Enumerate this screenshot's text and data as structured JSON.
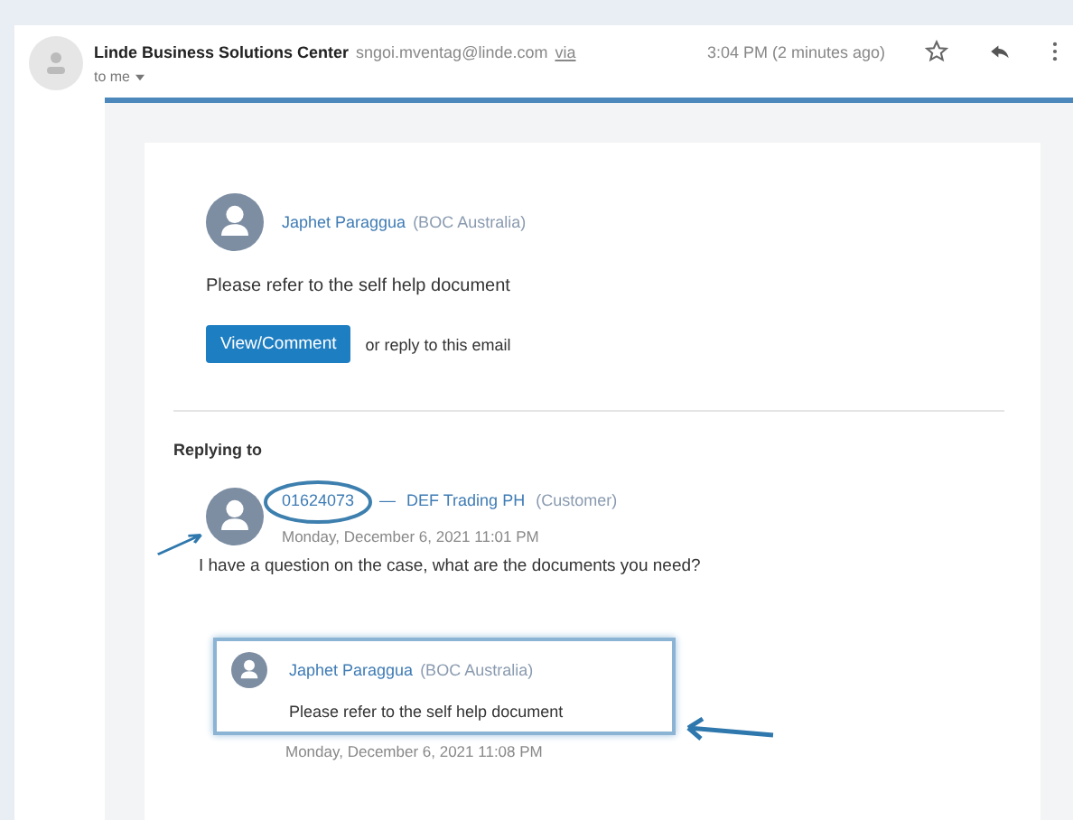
{
  "header": {
    "sender": "Linde Business Solutions Center",
    "address": "sngoi.mventag@linde.com",
    "via": "via",
    "time": "3:04 PM (2 minutes ago)",
    "recipient": "to me"
  },
  "message": {
    "author": "Japhet Paraggua",
    "org": "(BOC Australia)",
    "body": "Please refer to the self help document",
    "button": "View/Comment",
    "alt": "or reply to this email"
  },
  "replying": {
    "heading": "Replying to",
    "case": "01624073",
    "separator": "—",
    "customer": "DEF Trading PH",
    "role": "(Customer)",
    "date": "Monday, December 6, 2021 11:01 PM",
    "question": "I have a question on the case, what are the documents you need?",
    "quote": {
      "author": "Japhet Paraggua",
      "org": "(BOC Australia)",
      "body": "Please refer to the self help document",
      "date": "Monday, December 6, 2021 11:08 PM"
    }
  }
}
